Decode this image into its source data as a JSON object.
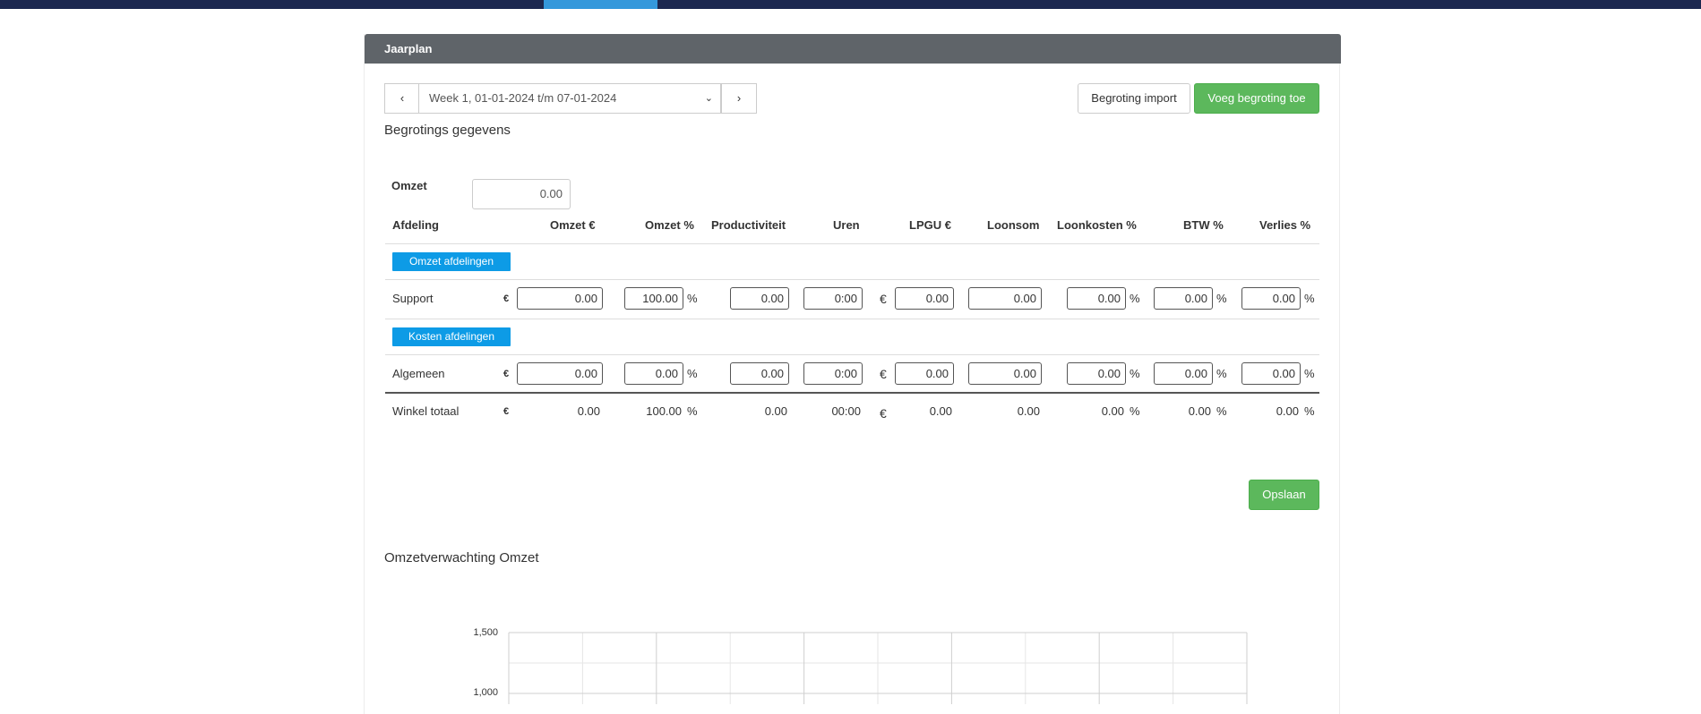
{
  "panel": {
    "title": "Jaarplan"
  },
  "nav": {
    "prev_label": "‹",
    "next_label": "›",
    "week_select": "Week 1, 01-01-2024 t/m 07-01-2024",
    "chevron": "⌄"
  },
  "toolbar": {
    "import_label": "Begroting import",
    "add_label": "Voeg begroting toe"
  },
  "section": {
    "title": "Begrotings gegevens"
  },
  "omzet": {
    "label": "Omzet",
    "value": "0.00"
  },
  "table": {
    "headers": {
      "afdeling": "Afdeling",
      "omzet_eur": "Omzet",
      "omzet_eur_sym": "€",
      "omzet_pct": "Omzet %",
      "productiviteit": "Productiviteit",
      "uren": "Uren",
      "lpgu": "LPGU €",
      "loonsom": "Loonsom",
      "loonkosten": "Loonkosten %",
      "btw": "BTW %",
      "verlies": "Verlies %"
    },
    "omzet_afdelingen_label": "Omzet afdelingen",
    "kosten_afdelingen_label": "Kosten afdelingen",
    "euro": "€",
    "pct": "%",
    "support": {
      "name": "Support",
      "omzet": "0.00",
      "omzet_pct": "100.00",
      "productiviteit": "0.00",
      "uren": "0:00",
      "lpgu": "0.00",
      "loonsom": "0.00",
      "loonkosten": "0.00",
      "btw": "0.00",
      "verlies": "0.00"
    },
    "algemeen": {
      "name": "Algemeen",
      "omzet": "0.00",
      "omzet_pct": "0.00",
      "productiviteit": "0.00",
      "uren": "0:00",
      "lpgu": "0.00",
      "loonsom": "0.00",
      "loonkosten": "0.00",
      "btw": "0.00",
      "verlies": "0.00"
    },
    "totaal": {
      "name": "Winkel totaal",
      "omzet": "0.00",
      "omzet_pct": "100.00",
      "productiviteit": "0.00",
      "uren": "00:00",
      "lpgu": "0.00",
      "loonsom": "0.00",
      "loonkosten": "0.00",
      "btw": "0.00",
      "verlies": "0.00"
    }
  },
  "save_label": "Opslaan",
  "chart": {
    "title": "Omzetverwachting Omzet",
    "y_ticks": [
      "1,500",
      "1,000"
    ]
  }
}
